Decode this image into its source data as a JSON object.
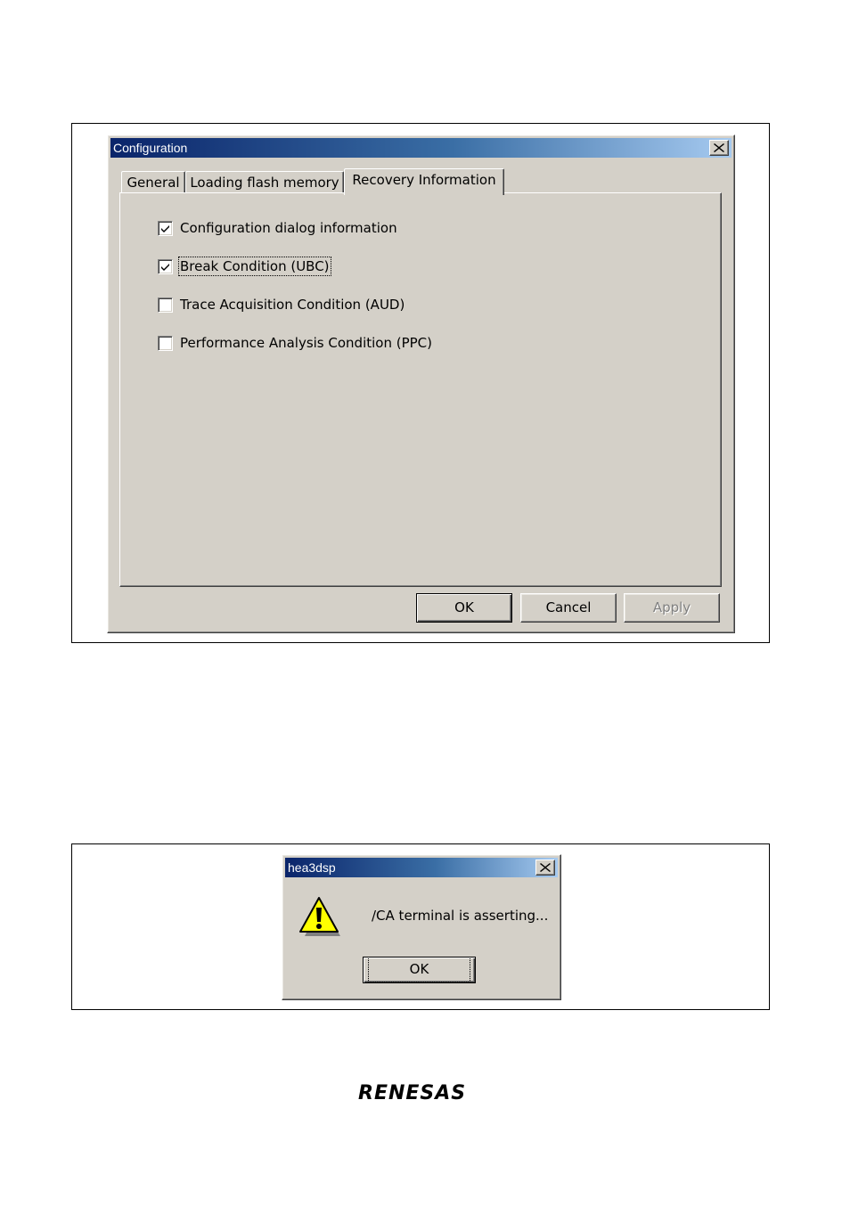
{
  "config_dialog": {
    "title": "Configuration",
    "tabs": [
      {
        "label": "General",
        "active": false
      },
      {
        "label": "Loading flash memory",
        "active": false
      },
      {
        "label": "Recovery Information",
        "active": true
      }
    ],
    "options": [
      {
        "label": "Configuration dialog information",
        "mnemonic": "C",
        "checked": true
      },
      {
        "label": "Break Condition (UBC)",
        "mnemonic": "B",
        "checked": true
      },
      {
        "label": "Trace Acquisition Condition (AUD)",
        "mnemonic": "T",
        "checked": false
      },
      {
        "label": "Performance Analysis Condition (PPC)",
        "mnemonic": "P",
        "checked": false
      }
    ],
    "buttons": {
      "ok": "OK",
      "cancel": "Cancel",
      "apply": "Apply"
    }
  },
  "alert_dialog": {
    "title": "hea3dsp",
    "message": "/CA terminal is asserting...",
    "ok_label": "OK",
    "icon": "warning-icon"
  },
  "brand": {
    "name": "RENESAS"
  }
}
